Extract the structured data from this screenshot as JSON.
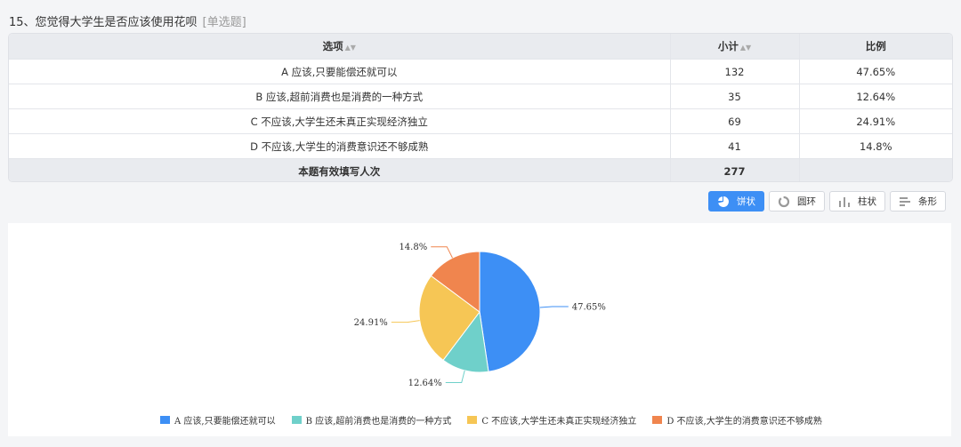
{
  "question": {
    "title": "15、您觉得大学生是否应该使用花呗",
    "type": "[单选题]"
  },
  "table": {
    "headers": [
      "选项",
      "小计",
      "比例"
    ],
    "rows": [
      {
        "option": "A 应该,只要能偿还就可以",
        "count": "132",
        "ratio": "47.65%"
      },
      {
        "option": "B 应该,超前消费也是消费的一种方式",
        "count": "35",
        "ratio": "12.64%"
      },
      {
        "option": "C 不应该,大学生还未真正实现经济独立",
        "count": "69",
        "ratio": "24.91%"
      },
      {
        "option": "D 不应该,大学生的消费意识还不够成熟",
        "count": "41",
        "ratio": "14.8%"
      }
    ],
    "total_label": "本题有效填写人次",
    "total_count": "277"
  },
  "buttons": [
    {
      "label": "饼状",
      "icon": "pie-icon",
      "active": true
    },
    {
      "label": "圆环",
      "icon": "ring-icon",
      "active": false
    },
    {
      "label": "柱状",
      "icon": "bar-icon",
      "active": false
    },
    {
      "label": "条形",
      "icon": "hbar-icon",
      "active": false
    }
  ],
  "chart_data": {
    "type": "pie",
    "categories": [
      "A 应该,只要能偿还就可以",
      "B 应该,超前消费也是消费的一种方式",
      "C 不应该,大学生还未真正实现经济独立",
      "D 不应该,大学生的消费意识还不够成熟"
    ],
    "values": [
      47.65,
      12.64,
      24.91,
      14.8
    ],
    "labels": [
      "47.65%",
      "12.64%",
      "24.91%",
      "14.8%"
    ],
    "colors": [
      "#3d8ff5",
      "#6fd0ca",
      "#f6c655",
      "#f0854e"
    ],
    "legend_position": "bottom"
  }
}
